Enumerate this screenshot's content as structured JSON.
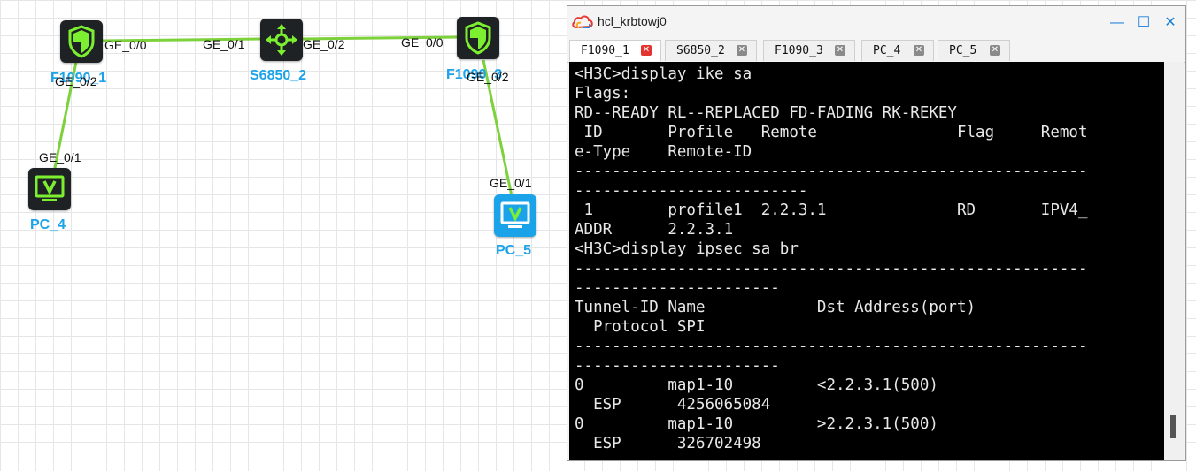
{
  "topology": {
    "nodes": [
      {
        "id": "F1090_1",
        "label": "F1090_1",
        "type": "firewall",
        "color": "#1aa3e8"
      },
      {
        "id": "S6850_2",
        "label": "S6850_2",
        "type": "switch",
        "color": "#1aa3e8"
      },
      {
        "id": "F1090_3",
        "label": "F1090_3",
        "type": "firewall",
        "color": "#1aa3e8"
      },
      {
        "id": "PC_4",
        "label": "PC_4",
        "type": "pc",
        "color": "#1aa3e8"
      },
      {
        "id": "PC_5",
        "label": "PC_5",
        "type": "pc",
        "color": "#1aa3e8",
        "selected": true
      }
    ],
    "ports": {
      "f1_ge00": "GE_0/0",
      "f1_ge02": "GE_0/2",
      "s2_ge01": "GE_0/1",
      "s2_ge02": "GE_0/2",
      "f3_ge00": "GE_0/0",
      "f3_ge02": "GE_0/2",
      "pc4_ge01": "GE_0/1",
      "pc5_ge01": "GE_0/1"
    },
    "link_color": "#7dd13a",
    "icon_accent": "#7cf030"
  },
  "window": {
    "title": "hcl_krbtowj0",
    "buttons": {
      "minimize": "—",
      "maximize": "☐",
      "close": "✕"
    },
    "tabs": [
      {
        "label": "F1090_1",
        "active": true
      },
      {
        "label": "S6850_2",
        "active": false
      },
      {
        "label": "F1090_3",
        "active": false
      },
      {
        "label": "PC_4",
        "active": false
      },
      {
        "label": "PC_5",
        "active": false
      }
    ],
    "tab_close": "✕"
  },
  "terminal": {
    "lines": [
      "<H3C>display ike sa",
      "Flags:",
      "RD--READY RL--REPLACED FD-FADING RK-REKEY",
      " ID       Profile   Remote               Flag     Remot",
      "e-Type    Remote-ID",
      "-------------------------------------------------------",
      "-------------------------",
      " 1        profile1  2.2.3.1              RD       IPV4_",
      "ADDR      2.2.3.1",
      "<H3C>display ipsec sa br",
      "-------------------------------------------------------",
      "----------------------",
      "Tunnel-ID Name            Dst Address(port)",
      "  Protocol SPI",
      "-------------------------------------------------------",
      "----------------------",
      "0         map1-10         <2.2.3.1(500)",
      "  ESP      4256065084",
      "0         map1-10         >2.2.3.1(500)",
      "  ESP      326702498"
    ]
  }
}
